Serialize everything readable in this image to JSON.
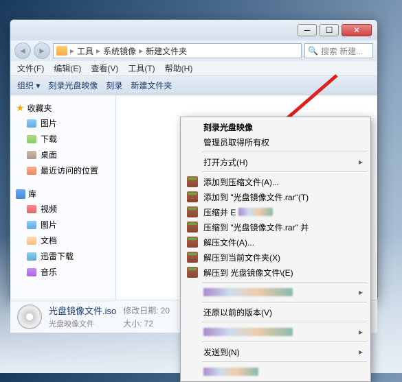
{
  "breadcrumb": {
    "p1": "工具",
    "p2": "系统镜像",
    "p3": "新建文件夹"
  },
  "search": {
    "placeholder": "搜索 新建..."
  },
  "menubar": {
    "file": "文件(F)",
    "edit": "编辑(E)",
    "view": "查看(V)",
    "tools": "工具(T)",
    "help": "帮助(H)"
  },
  "toolbar": {
    "organize": "组织 ▾",
    "burn": "刻录光盘映像",
    "burn2": "刻录",
    "newfolder": "新建文件夹"
  },
  "sidebar": {
    "fav": "收藏夹",
    "fav_items": {
      "pic": "图片",
      "dl": "下载",
      "desk": "桌面",
      "recent": "最近访问的位置"
    },
    "lib": "库",
    "lib_items": {
      "vid": "视频",
      "pic": "图片",
      "doc": "文档",
      "xl": "迅雷下载",
      "mus": "音乐"
    }
  },
  "details": {
    "name": "光盘镜像文件.iso",
    "type": "光盘映像文件",
    "date_label": "修改日期:",
    "date_val": "20",
    "size_label": "大小:",
    "size_val": "72"
  },
  "ctx": {
    "burn": "刻录光盘映像",
    "admin": "管理员取得所有权",
    "openwith": "打开方式(H)",
    "addarchive": "添加到压缩文件(A)...",
    "addtorar": "添加到 \"光盘镜像文件.rar\"(T)",
    "compress_email": "压缩并 E",
    "compress_to": "压缩到 \"光盘镜像文件.rar\" 并",
    "extract": "解压文件(A)...",
    "extract_here": "解压到当前文件夹(X)",
    "extract_to": "解压到 光盘镜像文件\\(E)",
    "restore": "还原以前的版本(V)",
    "sendto": "发送到(N)"
  }
}
